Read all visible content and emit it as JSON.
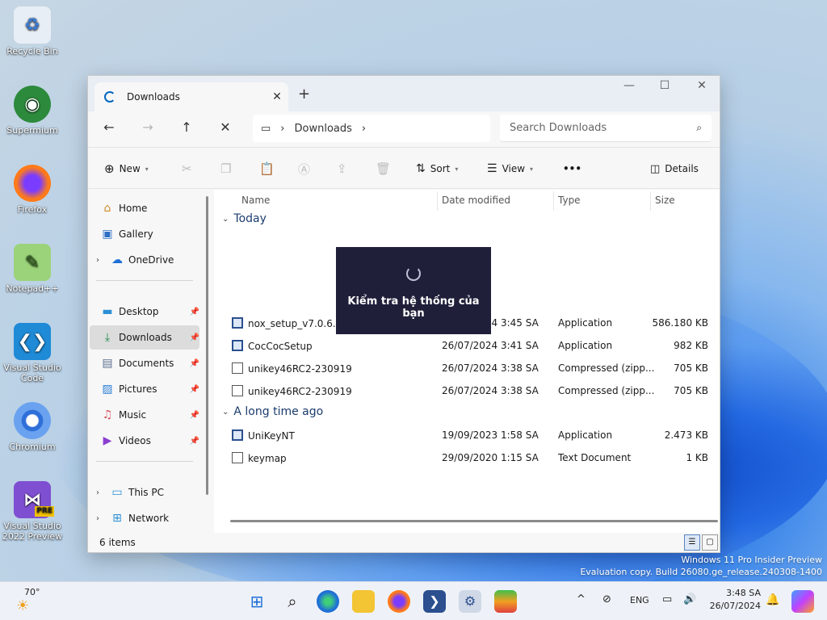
{
  "desktop": {
    "icons": [
      {
        "label": "Recycle Bin"
      },
      {
        "label": "Supermium"
      },
      {
        "label": "Firefox"
      },
      {
        "label": "Notepad++"
      },
      {
        "label": "Visual Studio Code"
      },
      {
        "label": "Chromium"
      },
      {
        "label": "Visual Studio 2022 Preview"
      }
    ],
    "watermark_line1": "Windows 11 Pro Insider Preview",
    "watermark_line2": "Evaluation copy. Build 26080.ge_release.240308-1400"
  },
  "explorer": {
    "tab_title": "Downloads",
    "address": "Downloads",
    "search_placeholder": "Search Downloads",
    "toolbar": {
      "new_label": "New",
      "sort_label": "Sort",
      "view_label": "View",
      "more_label": "•••",
      "details_label": "Details"
    },
    "sidebar": {
      "home": "Home",
      "gallery": "Gallery",
      "onedrive": "OneDrive",
      "desktop": "Desktop",
      "downloads": "Downloads",
      "documents": "Documents",
      "pictures": "Pictures",
      "music": "Music",
      "videos": "Videos",
      "thispc": "This PC",
      "network": "Network"
    },
    "columns": {
      "name": "Name",
      "date": "Date modified",
      "type": "Type",
      "size": "Size"
    },
    "groups": {
      "today": "Today",
      "longago": "A long time ago"
    },
    "files": [
      {
        "name": "nox_setup_v7.0.6.0_full_intl",
        "date": "26/07/2024 3:45 SA",
        "type": "Application",
        "size": "586.180 KB"
      },
      {
        "name": "CocCocSetup",
        "date": "26/07/2024 3:41 SA",
        "type": "Application",
        "size": "982 KB"
      },
      {
        "name": "unikey46RC2-230919",
        "date": "26/07/2024 3:38 SA",
        "type": "Compressed (zipp...",
        "size": "705 KB"
      },
      {
        "name": "unikey46RC2-230919",
        "date": "26/07/2024 3:38 SA",
        "type": "Compressed (zipp...",
        "size": "705 KB"
      },
      {
        "name": "UniKeyNT",
        "date": "19/09/2023 1:58 SA",
        "type": "Application",
        "size": "2.473 KB"
      },
      {
        "name": "keymap",
        "date": "29/09/2020 1:15 SA",
        "type": "Text Document",
        "size": "1 KB"
      }
    ],
    "status_count": "6 items"
  },
  "overlay": {
    "message": "Kiểm tra hệ thống của bạn"
  },
  "taskbar": {
    "weather_temp": "70°",
    "lang": "ENG",
    "time": "3:48 SA",
    "date": "26/07/2024",
    "pre_badge": "PRE"
  }
}
